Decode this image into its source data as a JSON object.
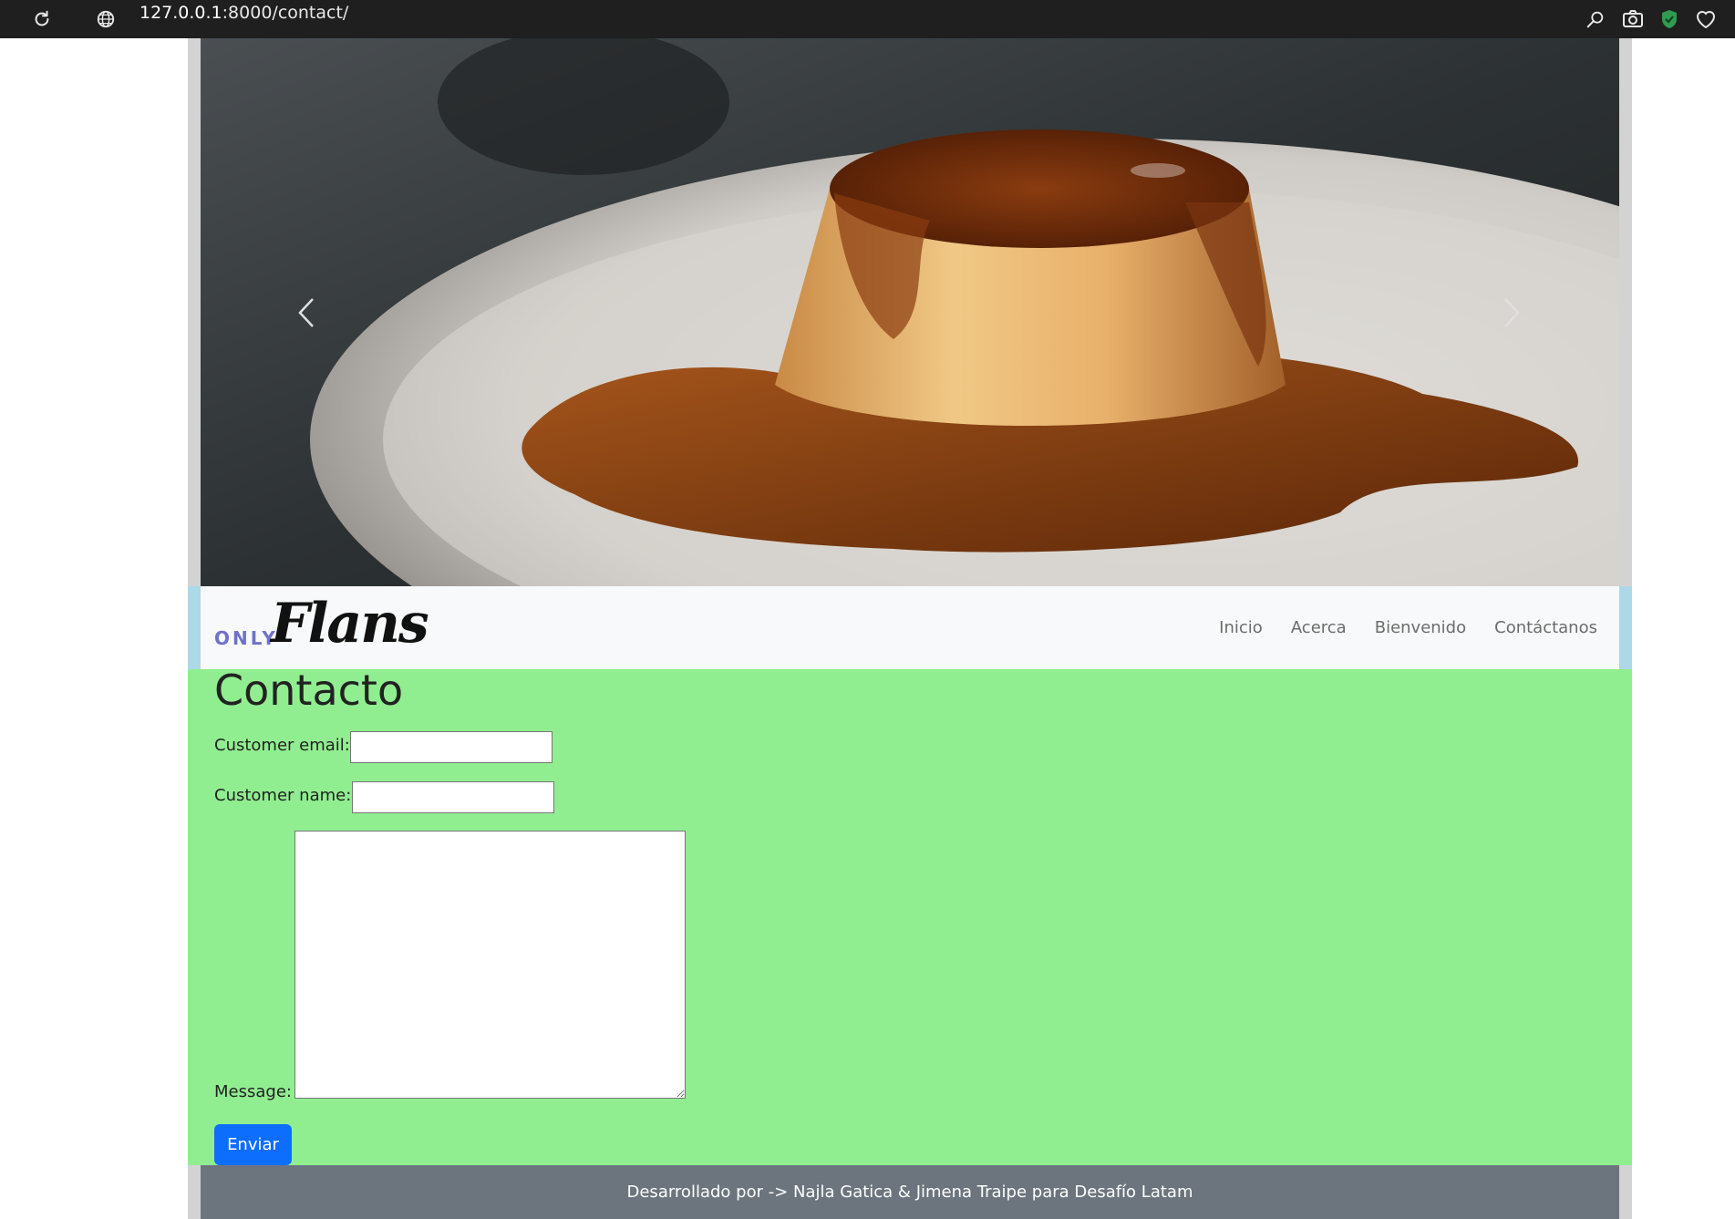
{
  "browser": {
    "url_host": "127.0.0.1",
    "url_path": ":8000/contact/",
    "icons": [
      "reload-icon",
      "site-info-icon",
      "zoom-icon",
      "camera-icon",
      "shield-icon",
      "heart-icon"
    ]
  },
  "carousel": {
    "image_subject": "flan with caramel sauce on a plate",
    "prev_icon": "chevron-left-icon",
    "next_icon": "chevron-right-icon"
  },
  "navbar": {
    "logo_small": "ONLY",
    "logo_script": "Flans",
    "links": [
      {
        "label": "Inicio"
      },
      {
        "label": "Acerca"
      },
      {
        "label": "Bienvenido"
      },
      {
        "label": "Contáctanos"
      }
    ]
  },
  "contact": {
    "title": "Contacto",
    "email_label": "Customer email:",
    "email_value": "",
    "name_label": "Customer name:",
    "name_value": "",
    "message_label": "Message:",
    "message_value": "",
    "submit_label": "Enviar"
  },
  "footer": {
    "text": "Desarrollado por -> Najla Gatica & Jimena Traipe para Desafío Latam"
  },
  "colors": {
    "content_bg": "#90ee90",
    "navbar_accent": "#add8e6",
    "submit_bg": "#0d6efd",
    "footer_bg": "#6c757d"
  }
}
